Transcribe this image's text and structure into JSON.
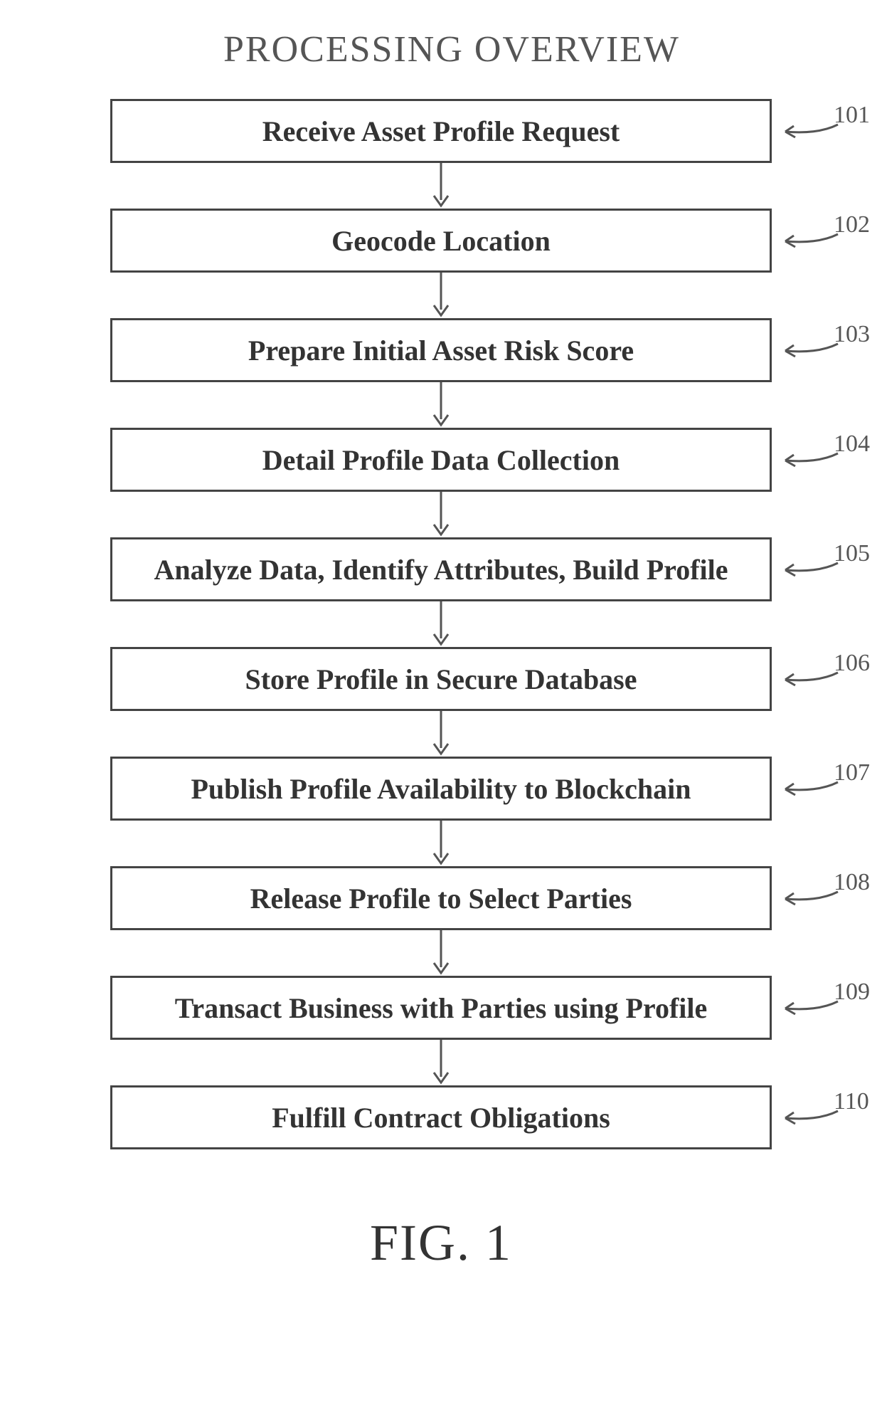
{
  "title": "PROCESSING OVERVIEW",
  "figure_caption": "FIG. 1",
  "steps": [
    {
      "label": "Receive Asset Profile Request",
      "ref": "101"
    },
    {
      "label": "Geocode Location",
      "ref": "102"
    },
    {
      "label": "Prepare Initial Asset Risk Score",
      "ref": "103"
    },
    {
      "label": "Detail Profile Data Collection",
      "ref": "104"
    },
    {
      "label": "Analyze Data, Identify Attributes, Build Profile",
      "ref": "105"
    },
    {
      "label": "Store Profile in Secure Database",
      "ref": "106"
    },
    {
      "label": "Publish Profile Availability to Blockchain",
      "ref": "107"
    },
    {
      "label": "Release Profile to Select Parties",
      "ref": "108"
    },
    {
      "label": "Transact Business with Parties using Profile",
      "ref": "109"
    },
    {
      "label": "Fulfill Contract Obligations",
      "ref": "110"
    }
  ]
}
